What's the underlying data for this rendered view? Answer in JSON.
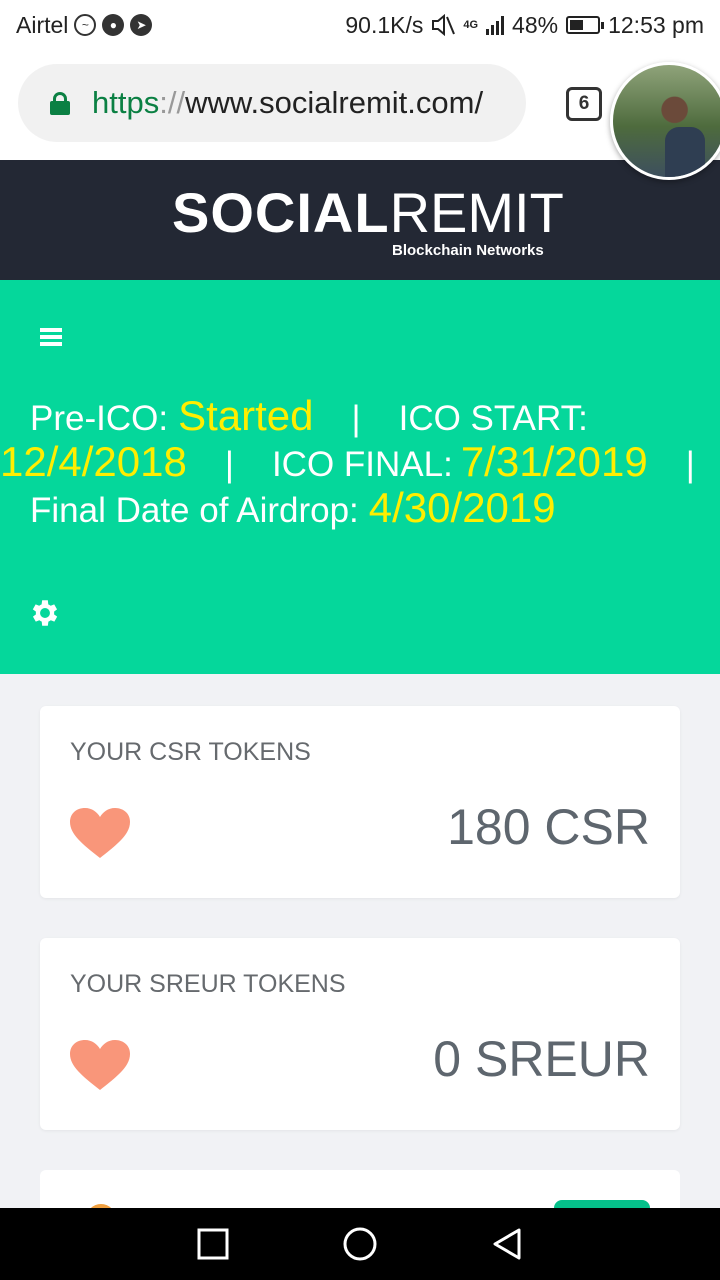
{
  "status_bar": {
    "carrier": "Airtel",
    "speed": "90.1K/s",
    "network": "4G",
    "battery_percent": "48%",
    "battery_level": 0.48,
    "time": "12:53 pm"
  },
  "browser": {
    "url_scheme": "https",
    "url_sep": "://",
    "url_host": "www.socialremit.com/",
    "tabs_count": "6"
  },
  "brand": {
    "name_bold": "SOCIAL",
    "name_light": "REMIT",
    "tagline": "Blockchain Networks",
    "header_color": "#232834"
  },
  "banner": {
    "background": "#05d79b",
    "highlight_color": "#ffee00",
    "preico_label": "Pre-ICO:",
    "preico_value": "Started",
    "separator": "|",
    "ico_start_label": "ICO START:",
    "ico_start_value": "12/4/2018",
    "ico_final_label": "ICO FINAL:",
    "ico_final_value": "7/31/2019",
    "airdrop_label": "Final Date of Airdrop:",
    "airdrop_value": "4/30/2019"
  },
  "cards": [
    {
      "title": "YOUR CSR TOKENS",
      "value": "180 CSR",
      "icon": "heart-icon"
    },
    {
      "title": "YOUR SREUR TOKENS",
      "value": "0 SREUR",
      "icon": "heart-icon"
    }
  ],
  "icons": {
    "menu": "menu-icon",
    "settings": "gear-icon",
    "lock": "lock-icon",
    "heart_color": "#f9967a"
  }
}
